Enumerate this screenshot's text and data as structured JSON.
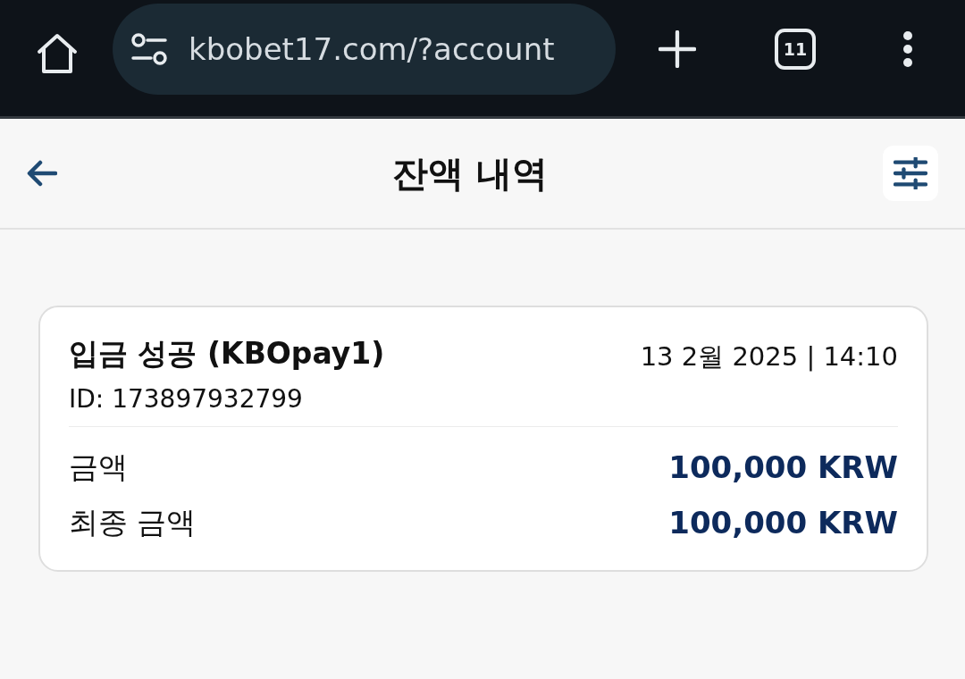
{
  "browser_bar": {
    "url": "kbobet17.com/?account",
    "tab_count": "11"
  },
  "header": {
    "title": "잔액 내역"
  },
  "transactions": [
    {
      "title": "입금 성공 (KBOpay1)",
      "datetime": "13 2월 2025 | 14:10",
      "id": "ID: 173897932799",
      "rows": [
        {
          "label": "금액",
          "value": "100,000 KRW"
        },
        {
          "label": "최종 금액",
          "value": "100,000 KRW"
        }
      ]
    }
  ]
}
